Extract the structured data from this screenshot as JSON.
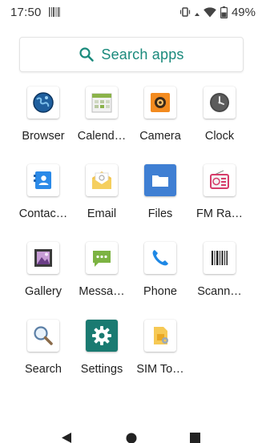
{
  "status": {
    "time": "17:50",
    "battery": "49%",
    "icons": [
      "barcode-notification-icon",
      "vibrate-icon",
      "data-arrows-icon",
      "wifi-icon",
      "battery-icon"
    ]
  },
  "search": {
    "label": "Search apps",
    "icon": "search-icon",
    "accent": "#1a8a7c"
  },
  "apps": [
    {
      "label": "Browser",
      "icon": "browser-icon"
    },
    {
      "label": "Calend…",
      "icon": "calendar-icon"
    },
    {
      "label": "Camera",
      "icon": "camera-icon"
    },
    {
      "label": "Clock",
      "icon": "clock-icon"
    },
    {
      "label": "Contac…",
      "icon": "contacts-icon"
    },
    {
      "label": "Email",
      "icon": "email-icon"
    },
    {
      "label": "Files",
      "icon": "files-icon"
    },
    {
      "label": "FM Ra…",
      "icon": "fm-radio-icon"
    },
    {
      "label": "Gallery",
      "icon": "gallery-icon"
    },
    {
      "label": "Messa…",
      "icon": "messaging-icon"
    },
    {
      "label": "Phone",
      "icon": "phone-icon"
    },
    {
      "label": "Scann…",
      "icon": "scanner-icon"
    },
    {
      "label": "Search",
      "icon": "search-app-icon"
    },
    {
      "label": "Settings",
      "icon": "settings-icon"
    },
    {
      "label": "SIM To…",
      "icon": "sim-toolkit-icon"
    }
  ],
  "nav": {
    "icons": [
      "back-icon",
      "home-icon",
      "recents-icon"
    ]
  }
}
